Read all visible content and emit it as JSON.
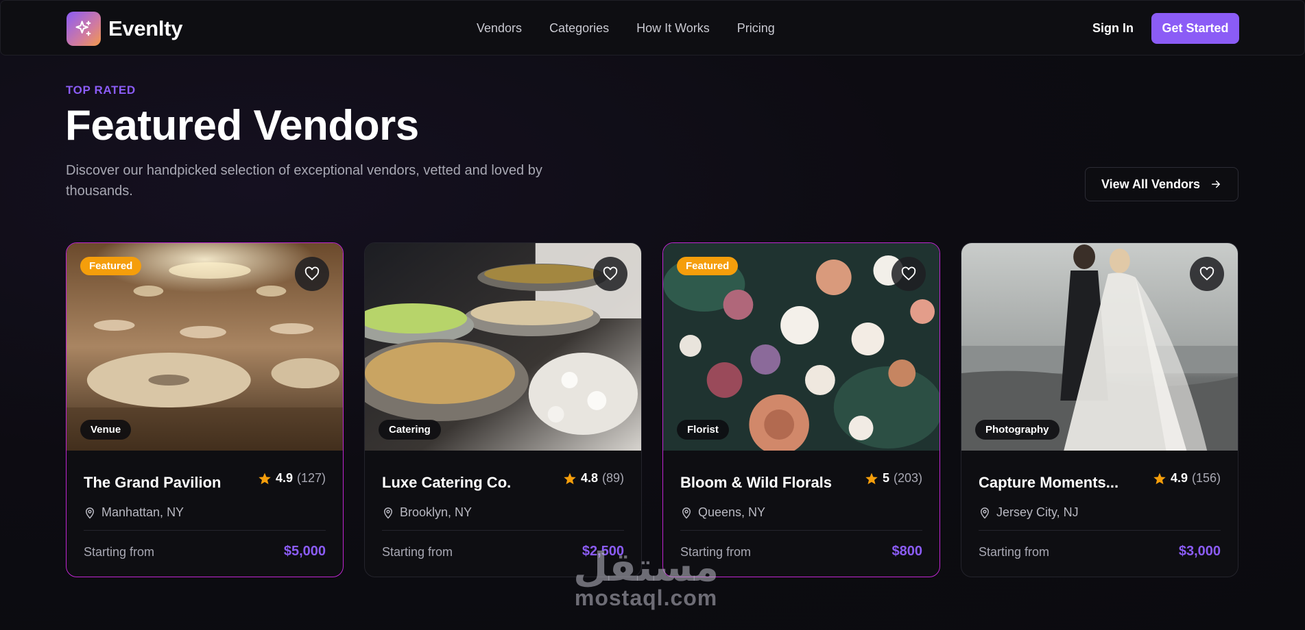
{
  "brand": {
    "name": "Evenlty"
  },
  "nav": {
    "links": [
      "Vendors",
      "Categories",
      "How It Works",
      "Pricing"
    ],
    "sign_in": "Sign In",
    "get_started": "Get Started"
  },
  "section": {
    "eyebrow": "TOP RATED",
    "title": "Featured Vendors",
    "subtitle": "Discover our handpicked selection of exceptional vendors, vetted and loved by thousands.",
    "view_all": "View All Vendors"
  },
  "colors": {
    "accent": "#8b5cf6",
    "featured_badge": "#f59e0b",
    "star": "#f59e0b",
    "featured_border": "#c026d3"
  },
  "cards": [
    {
      "name": "The Grand Pavilion",
      "category": "Venue",
      "featured": true,
      "badge": "Featured",
      "rating": "4.9",
      "reviews": "(127)",
      "location": "Manhattan, NY",
      "starting_label": "Starting from",
      "price": "$5,000"
    },
    {
      "name": "Luxe Catering Co.",
      "category": "Catering",
      "featured": false,
      "badge": "",
      "rating": "4.8",
      "reviews": "(89)",
      "location": "Brooklyn, NY",
      "starting_label": "Starting from",
      "price": "$2,500"
    },
    {
      "name": "Bloom & Wild Florals",
      "category": "Florist",
      "featured": true,
      "badge": "Featured",
      "rating": "5",
      "reviews": "(203)",
      "location": "Queens, NY",
      "starting_label": "Starting from",
      "price": "$800"
    },
    {
      "name": "Capture Moments...",
      "category": "Photography",
      "featured": false,
      "badge": "",
      "rating": "4.9",
      "reviews": "(156)",
      "location": "Jersey City, NJ",
      "starting_label": "Starting from",
      "price": "$3,000"
    }
  ],
  "watermark": {
    "arabic": "مستقل",
    "latin": "mostaql.com"
  }
}
